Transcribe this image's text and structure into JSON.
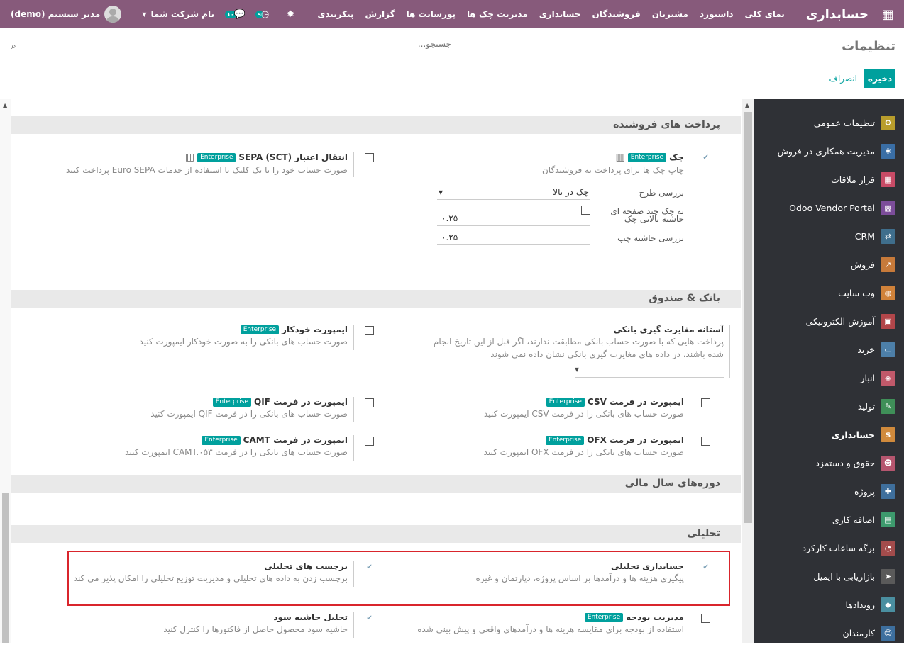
{
  "topbar": {
    "brand": "حسابداری",
    "menu": [
      "نمای کلی",
      "داشبورد",
      "مشتریان",
      "فروشندگان",
      "حسابداری",
      "مدیریت چک ها",
      "پورسانت ها",
      "گزارش",
      "پیکربندی"
    ],
    "user": "مدیر سیستم (demo)",
    "company": "نام شرکت شما",
    "activity_count": "۹",
    "message_count": "۱۰"
  },
  "control": {
    "title": "تنظیمات",
    "search_placeholder": "جستجو...",
    "save": "ذخیره",
    "discard": "انصراف"
  },
  "sidebar": [
    "تنظیمات عمومی",
    "مدیریت همکاری در فروش",
    "قرار ملاقات",
    "Odoo Vendor Portal",
    "CRM",
    "فروش",
    "وب سایت",
    "آموزش الکترونیکی",
    "خرید",
    "انبار",
    "تولید",
    "حسابداری",
    "حقوق و دستمزد",
    "پروژه",
    "اضافه کاری",
    "برگه ساعات کارکرد",
    "بازاریابی با ایمیل",
    "رویدادها",
    "کارمندان"
  ],
  "sections": {
    "vendor": "پرداخت های فروشنده",
    "bank": "بانک & صندوق",
    "fiscal": "دوره‌های سال مالی",
    "analytic": "تحلیلی"
  },
  "enterprise": "Enterprise",
  "s": {
    "check": {
      "label": "چک",
      "desc": "چاپ چک ها برای پرداخت به فروشندگان"
    },
    "check_layout_label": "بررسی طرح",
    "check_layout_value": "چک در بالا",
    "multi_label": "ته چک چند صفحه ای",
    "top_margin_label": "حاشیه بالایی چک",
    "top_margin_value": "۰.۲۵",
    "left_margin_label": "بررسی حاشیه چپ",
    "left_margin_value": "۰.۲۵",
    "sepa": {
      "label": "انتقال اعتبار (SCT) SEPA",
      "desc": "صورت حساب خود را با یک کلیک با استفاده از خدمات Euro SEPA پرداخت کنید"
    },
    "threshold": {
      "label": "آستانه مغایرت گیری بانکی",
      "desc": "پرداخت هایی که با صورت حساب بانکی مطابقت ندارند، اگر قبل از این تاریخ انجام شده باشند، در داده های مغایرت گیری بانکی نشان داده نمی شوند"
    },
    "autoimport": {
      "label": "ایمپورت خودکار",
      "desc": "صورت حساب های بانکی را به صورت خودکار ایمپورت کنید"
    },
    "csv": {
      "label": "ایمپورت در فرمت CSV",
      "desc": "صورت حساب های بانکی را در فرمت CSV ایمپورت کنید"
    },
    "qif": {
      "label": "ایمپورت در فرمت QIF",
      "desc": "صورت حساب های بانکی را در فرمت QIF ایمپورت کنید"
    },
    "ofx": {
      "label": "ایمپورت در فرمت OFX",
      "desc": "صورت حساب های بانکی را در فرمت OFX ایمپورت کنید"
    },
    "camt": {
      "label": "ایمپورت در فرمت CAMT",
      "desc": "صورت حساب های بانکی را در فرمت CAMT.۰۵۳ ایمپورت کنید"
    },
    "analytic_acc": {
      "label": "حسابداری تحلیلی",
      "desc": "پیگیری هزینه ها و درآمدها بر اساس پروژه، دپارتمان و غیره"
    },
    "analytic_tags": {
      "label": "برچسب های تحلیلی",
      "desc": "برچسب زدن به داده های تحلیلی و مدیریت توزیع تحلیلی را امکان پذیر می کند"
    },
    "budget": {
      "label": "مدیریت بودجه",
      "desc": "استفاده از بودجه برای مقایسه هزینه ها و درآمدهای واقعی و پیش بینی شده"
    },
    "margin": {
      "label": "تحلیل حاشیه سود",
      "desc": "حاشیه سود محصول حاصل از فاکتورها را کنترل کنید"
    }
  }
}
